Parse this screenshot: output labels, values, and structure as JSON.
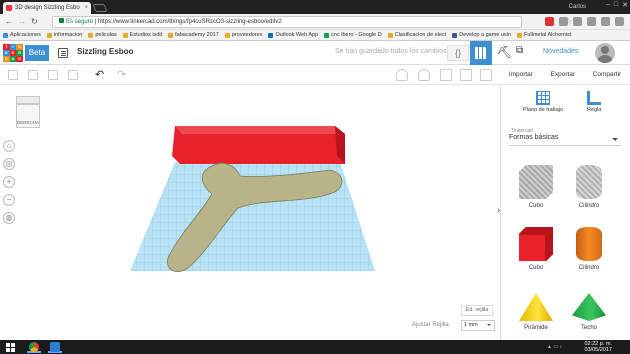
{
  "browser": {
    "tab_title": "3D design Sizzling Esbo",
    "user_name": "Carlos",
    "url_secure_label": "Es seguro",
    "url": "https://www.tinkercad.com/things/fp4cuSRzcO3-sizzling-esboo/editv2",
    "bookmarks": [
      {
        "label": "Aplicaciones",
        "icon": "apps-icon"
      },
      {
        "label": "informacion",
        "icon": "folder-icon"
      },
      {
        "label": "peliculas",
        "icon": "folder-icon"
      },
      {
        "label": "Estudios isdit",
        "icon": "folder-icon"
      },
      {
        "label": "fabacademy 2017",
        "icon": "folder-icon"
      },
      {
        "label": "proveedores",
        "icon": "folder-icon"
      },
      {
        "label": "Outlook Web App",
        "icon": "outlook-icon"
      },
      {
        "label": "cnc ibero - Google D",
        "icon": "drive-icon"
      },
      {
        "label": "Clasificacion de elect",
        "icon": "folder-icon"
      },
      {
        "label": "Develop a game usin",
        "icon": "facebook-icon"
      },
      {
        "label": "Fullmetal Alchemist",
        "icon": "folder-icon"
      }
    ]
  },
  "header": {
    "logo_letters": [
      "TIN",
      "KER",
      "CAD"
    ],
    "beta_label": "Beta",
    "design_title": "Sizzling Esboo",
    "saved_message": "Se han guardado todos los cambios.",
    "novedades_label": "Novedades"
  },
  "actions": {
    "import": "Importar",
    "export": "Exportar",
    "share": "Compartir"
  },
  "viewcube": {
    "face_label": "DERECHA"
  },
  "workplane": {
    "edit_grid": "Ed. rejilla",
    "snap_label": "Ajustar Rejilla",
    "snap_value": "1 mm"
  },
  "panel": {
    "workplane_tool": "Plano de trabajo",
    "ruler_tool": "Regla",
    "library_label": "Tinkercad",
    "library_value": "Formas básicas",
    "shapes": [
      {
        "label": "Cubo",
        "style": "hole-box"
      },
      {
        "label": "Cilindro",
        "style": "hole-cylinder"
      },
      {
        "label": "Cubo",
        "style": "red-box"
      },
      {
        "label": "Cilindro",
        "style": "orange-cylinder"
      },
      {
        "label": "Pirámide",
        "style": "yellow-pyramid"
      },
      {
        "label": "Techo",
        "style": "green-roof"
      }
    ]
  },
  "taskbar": {
    "time": "02:22 p. m.",
    "date": "03/05/2017"
  },
  "colors": {
    "accent": "#3d8fd1",
    "red_block": "#e8212b",
    "boomerang": "#b8b48a",
    "grid": "#9fd6ee"
  }
}
